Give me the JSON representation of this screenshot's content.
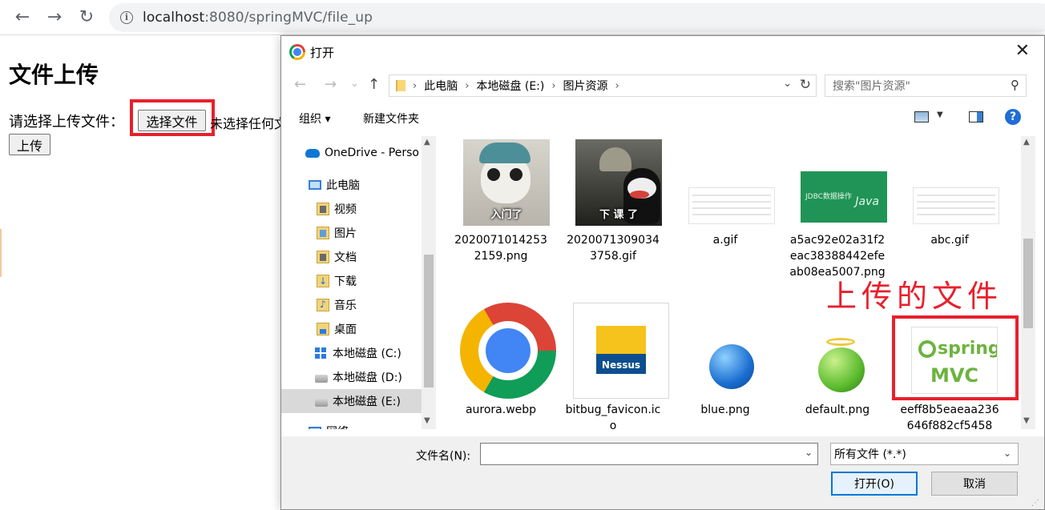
{
  "browser": {
    "back_icon": "←",
    "forward_icon": "→",
    "reload_icon": "↻",
    "info_icon": "i",
    "url_host": "localhost",
    "url_rest": ":8080/springMVC/file_up"
  },
  "page": {
    "heading": "文件上传",
    "file_label": "请选择上传文件：",
    "choose_file_button": "选择文件",
    "no_file_text": "未选择任何文件",
    "upload_button": "上传"
  },
  "dialog": {
    "title": "打开",
    "close_icon": "✕",
    "nav": {
      "back": "←",
      "forward": "→",
      "dropdown": "⌄",
      "up": "↑"
    },
    "breadcrumb": [
      "此电脑",
      "本地磁盘 (E:)",
      "图片资源"
    ],
    "breadcrumb_sep": "›",
    "breadcrumb_dropdown": "⌄",
    "refresh_icon": "↻",
    "search_placeholder": "搜索\"图片资源\"",
    "search_icon": "⚲",
    "toolbar": {
      "organize": "组织 ▾",
      "new_folder": "新建文件夹",
      "view_dropdown": "▼",
      "help": "?"
    },
    "nav_pane": [
      {
        "label": "OneDrive - Perso",
        "icon": "onedrive-icon"
      },
      {
        "label": "此电脑",
        "icon": "this-pc-icon"
      },
      {
        "label": "视频",
        "icon": "video-folder-icon"
      },
      {
        "label": "图片",
        "icon": "pictures-folder-icon"
      },
      {
        "label": "文档",
        "icon": "documents-folder-icon"
      },
      {
        "label": "下载",
        "icon": "downloads-folder-icon"
      },
      {
        "label": "音乐",
        "icon": "music-folder-icon"
      },
      {
        "label": "桌面",
        "icon": "desktop-folder-icon"
      },
      {
        "label": "本地磁盘 (C:)",
        "icon": "windows-drive-icon"
      },
      {
        "label": "本地磁盘 (D:)",
        "icon": "drive-icon"
      },
      {
        "label": "本地磁盘 (E:)",
        "icon": "drive-icon",
        "selected": true
      },
      {
        "label": "网络",
        "icon": "network-icon"
      }
    ],
    "files": [
      {
        "name": "20200710142532159.png",
        "caption": "入门了"
      },
      {
        "name": "20200713090343758.gif",
        "caption": "下 课 了"
      },
      {
        "name": "a.gif"
      },
      {
        "name": "a5ac92e02a31f2eac38388442efeab08ea5007.png",
        "jdbc_text": "JDBC数据操作",
        "java_text": "Java"
      },
      {
        "name": "abc.gif"
      },
      {
        "name": "aurora.webp"
      },
      {
        "name": "bitbug_favicon.ico",
        "logo_text": "Nessus"
      },
      {
        "name": "blue.png"
      },
      {
        "name": "default.png"
      },
      {
        "name": "eeff8b5eaeaa236646f882cf5458",
        "spring_text": "spring",
        "mvc_text": "MVC"
      }
    ],
    "annotation": "上传的文件",
    "filename_label": "文件名(N):",
    "filename_value": "",
    "filetype_value": "所有文件 (*.*)",
    "dropdown_arrow": "⌄",
    "open_button": "打开(O)",
    "cancel_button": "取消",
    "scroll_up": "▲",
    "scroll_down": "▼"
  },
  "colors": {
    "highlight": "#e8202c",
    "accent": "#0078d7",
    "selection": "#d9d9d9"
  }
}
